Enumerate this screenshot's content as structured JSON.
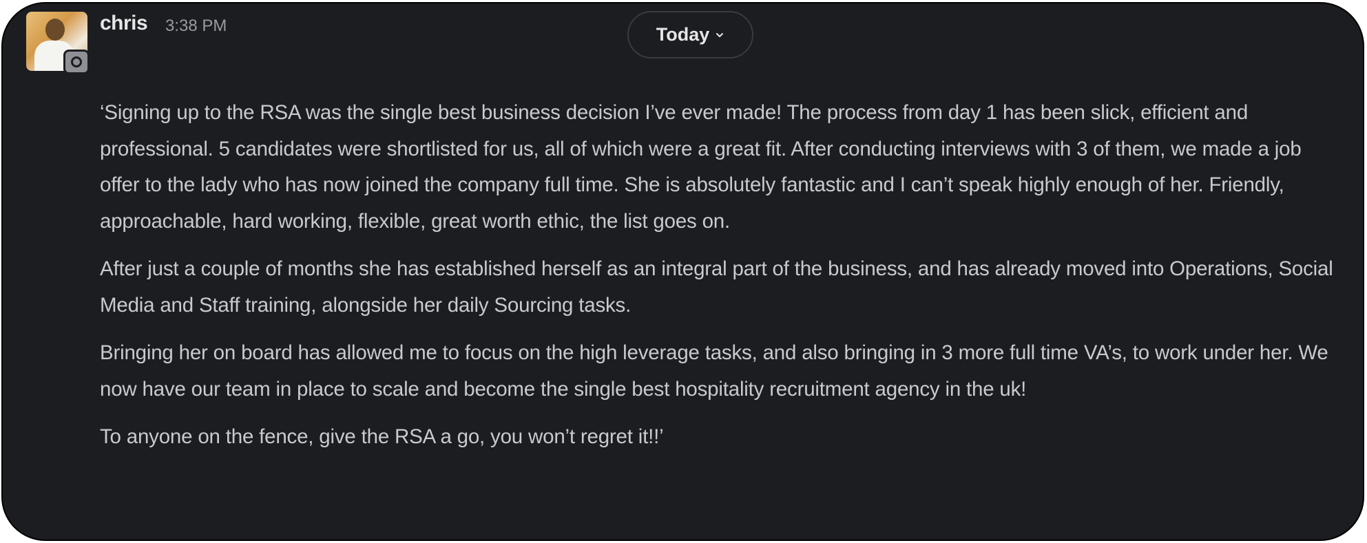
{
  "message": {
    "author": "chris",
    "timestamp": "3:38 PM",
    "date_divider": "Today",
    "paragraphs": [
      "‘Signing up to the RSA was the single best business decision I’ve ever made! The process from day 1 has been slick, efficient and professional. 5 candidates were shortlisted for us, all of which were a great fit. After conducting interviews with 3 of them, we made a job offer to the lady who has now joined the company full time. She is absolutely fantastic and I can’t speak highly enough of her. Friendly, approachable, hard working, flexible, great worth ethic, the list goes on.",
      "After just a couple of months she has established herself as an integral part of the business, and has already moved into Operations, Social Media and Staff training, alongside her daily Sourcing tasks.",
      "Bringing her on board has allowed me to focus on the high leverage tasks, and also bringing in 3 more full time VA’s, to work under her. We now have our team in place to scale and become the single best hospitality recruitment agency in the uk!",
      "To anyone on the fence, give the RSA a go, you won’t regret it!!’"
    ]
  },
  "icons": {
    "avatar": "user-photo",
    "status": "status-badge-icon",
    "chevron": "chevron-down-icon"
  },
  "colors": {
    "background": "#1c1d21",
    "text": "#c9cacd",
    "author": "#e6e6e8",
    "muted": "#9a9ba0"
  }
}
